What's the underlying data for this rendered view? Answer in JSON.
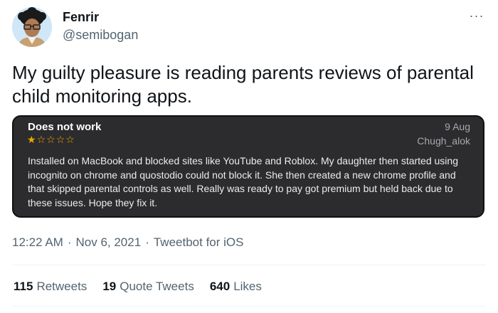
{
  "author": {
    "display_name": "Fenrir",
    "handle": "@semibogan",
    "more_icon": "···"
  },
  "tweet": {
    "text": "My guilty pleasure is reading parents reviews of parental child monitoring apps."
  },
  "review": {
    "title": "Does not work",
    "date": "9 Aug",
    "author": "Chugh_alok",
    "rating": 1,
    "max_rating": 5,
    "star_color": "#f0a800",
    "body": "Installed on MacBook and blocked sites like YouTube and Roblox. My daughter then started using incognito on chrome and quostodio could not block it. She then created a new chrome profile and that skipped parental controls as well. Really was ready to pay got premium but held back due to these issues. Hope they fix it.",
    "background": "#2c2c2e"
  },
  "meta": {
    "time": "12:22 AM",
    "separator": "·",
    "date": "Nov 6, 2021",
    "source": "Tweetbot for iOS"
  },
  "stats": {
    "retweets_count": "115",
    "retweets_label": "Retweets",
    "quotes_count": "19",
    "quotes_label": "Quote Tweets",
    "likes_count": "640",
    "likes_label": "Likes"
  },
  "colors": {
    "text_primary": "#0f1419",
    "text_secondary": "#536471"
  }
}
